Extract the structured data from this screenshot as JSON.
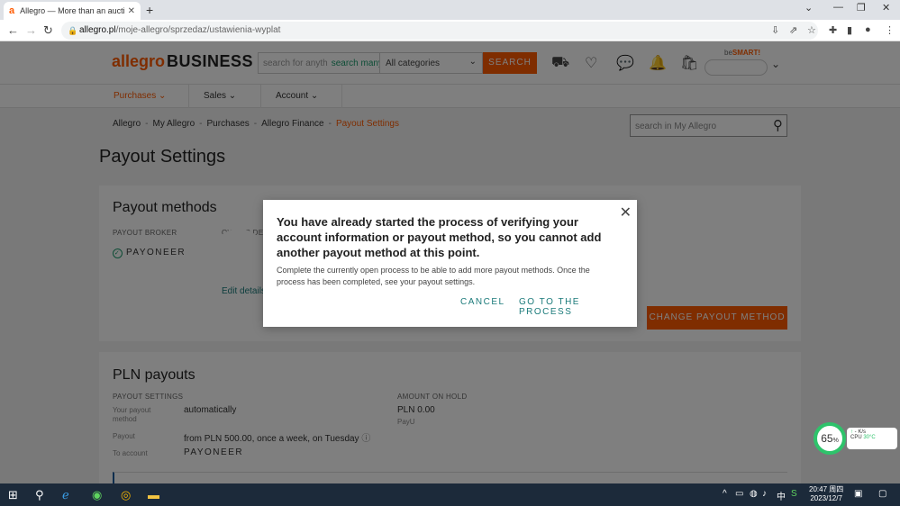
{
  "browser": {
    "tab_title": "Allegro — More than an aucti",
    "tab_favicon": "a",
    "tab_close": "✕",
    "new_tab": "+",
    "url_host": "allegro.pl",
    "url_path": "/moje-allegro/sprzedaz/ustawienia-wyplat"
  },
  "header": {
    "logo_allegro": "allegro",
    "logo_business": "BUSINESS",
    "search_placeholder": "search for anyth",
    "search_many": "search many",
    "category": "All categories",
    "search_button": "SEARCH",
    "besmart_prefix": "be",
    "besmart_brand": "SMART!"
  },
  "subnav": {
    "purchases": "Purchases",
    "sales": "Sales",
    "account": "Account"
  },
  "breadcrumb": [
    "Allegro",
    "My Allegro",
    "Purchases",
    "Allegro Finance",
    "Payout Settings"
  ],
  "myallegro_search_placeholder": "search in My Allegro",
  "page_title": "Payout Settings",
  "payout_methods": {
    "title": "Payout methods",
    "col_broker": "PAYOUT BROKER",
    "col_owner": "OWNER DET",
    "broker": "PAYONEER",
    "edit_details": "Edit details",
    "change_button": "CHANGE PAYOUT METHOD"
  },
  "pln_payouts": {
    "title": "PLN payouts",
    "settings_label": "PAYOUT SETTINGS",
    "your_method_label": "Your payout method",
    "your_method_value": "automatically",
    "payout_label": "Payout",
    "payout_value": "from PLN 500.00, once a week, on Tuesday",
    "info_icon": "ⓘ",
    "to_account_label": "To account",
    "to_account_value": "PAYONEER",
    "on_hold_label": "AMOUNT ON HOLD",
    "on_hold_value": "PLN 0.00",
    "on_hold_provider": "PayU"
  },
  "modal": {
    "title": "You have already started the process of verifying your account information or payout method, so you cannot add another payout method at this point.",
    "body": "Complete the currently open process to be able to add more payout methods. Once the process has been completed, see your payout settings.",
    "cancel": "CANCEL",
    "go": "GO TO THE PROCESS",
    "close": "✕"
  },
  "widget": {
    "cpu_percent": "65",
    "cpu_percent_sign": "%",
    "speed": "- K/s",
    "cpu_label": "CPU",
    "cpu_temp": "30°C"
  },
  "taskbar": {
    "time": "20:47 周四",
    "date": "2023/12/7",
    "ime": "中"
  },
  "colors": {
    "brand": "#ff5a00",
    "link": "#1a7a7a",
    "overlay": "rgba(0,0,0,0.5)"
  }
}
